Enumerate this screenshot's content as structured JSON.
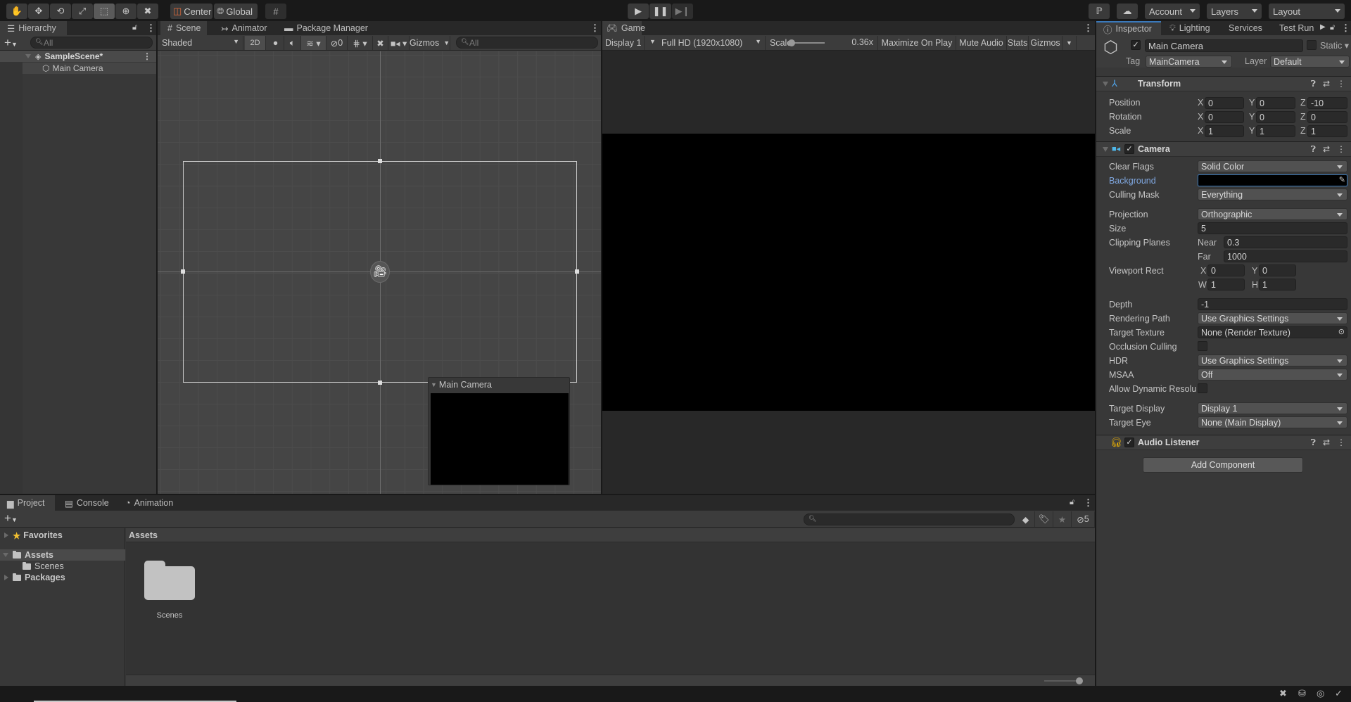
{
  "toolbar": {
    "tools": [
      "hand-tool",
      "move-tool",
      "rotate-tool",
      "scale-tool",
      "rect-tool",
      "transform-tool",
      "custom-editor-tool"
    ],
    "active_tool": "rect-tool",
    "pivot_label": "Center",
    "space_label": "Global",
    "account_label": "Account",
    "layers_label": "Layers",
    "layout_label": "Layout"
  },
  "hierarchy": {
    "tab_label": "Hierarchy",
    "search_placeholder": "All",
    "scene_name": "SampleScene*",
    "items": [
      {
        "label": "Main Camera"
      }
    ]
  },
  "scene_view": {
    "tabs": [
      {
        "label": "Scene"
      },
      {
        "label": "Animator"
      },
      {
        "label": "Package Manager"
      }
    ],
    "shading_mode": "Shaded",
    "mode_2d_label": "2D",
    "hidden_count": "0",
    "gizmos_label": "Gizmos",
    "search_placeholder": "All",
    "camera_preview_title": "Main Camera"
  },
  "game_view": {
    "tab_label": "Game",
    "display": "Display 1",
    "resolution": "Full HD (1920x1080)",
    "scale_label": "Scale",
    "scale_value": "0.36x",
    "scale_slider_fraction": 0.0,
    "maximize_label": "Maximize On Play",
    "mute_label": "Mute Audio",
    "stats_label": "Stats",
    "gizmos_label": "Gizmos"
  },
  "inspector": {
    "tabs": [
      {
        "label": "Inspector"
      },
      {
        "label": "Lighting"
      },
      {
        "label": "Services"
      },
      {
        "label": "Test Run"
      }
    ],
    "object_name": "Main Camera",
    "static_label": "Static",
    "tag_label": "Tag",
    "tag_value": "MainCamera",
    "layer_label": "Layer",
    "layer_value": "Default",
    "transform": {
      "title": "Transform",
      "position": {
        "label": "Position",
        "x": "0",
        "y": "0",
        "z": "-10"
      },
      "rotation": {
        "label": "Rotation",
        "x": "0",
        "y": "0",
        "z": "0"
      },
      "scale": {
        "label": "Scale",
        "x": "1",
        "y": "1",
        "z": "1"
      }
    },
    "camera": {
      "title": "Camera",
      "clear_flags": {
        "label": "Clear Flags",
        "value": "Solid Color"
      },
      "background": {
        "label": "Background",
        "color": "#000000"
      },
      "culling_mask": {
        "label": "Culling Mask",
        "value": "Everything"
      },
      "projection": {
        "label": "Projection",
        "value": "Orthographic"
      },
      "size": {
        "label": "Size",
        "value": "5"
      },
      "clipping": {
        "label": "Clipping Planes",
        "near_label": "Near",
        "near": "0.3",
        "far_label": "Far",
        "far": "1000"
      },
      "viewport": {
        "label": "Viewport Rect",
        "x": "0",
        "y": "0",
        "w": "1",
        "h": "1"
      },
      "depth": {
        "label": "Depth",
        "value": "-1"
      },
      "rendering_path": {
        "label": "Rendering Path",
        "value": "Use Graphics Settings"
      },
      "target_texture": {
        "label": "Target Texture",
        "value": "None (Render Texture)"
      },
      "occlusion_culling": {
        "label": "Occlusion Culling"
      },
      "hdr": {
        "label": "HDR",
        "value": "Use Graphics Settings"
      },
      "msaa": {
        "label": "MSAA",
        "value": "Off"
      },
      "dynamic_res": {
        "label": "Allow Dynamic Resolu"
      },
      "target_display": {
        "label": "Target Display",
        "value": "Display 1"
      },
      "target_eye": {
        "label": "Target Eye",
        "value": "None (Main Display)"
      }
    },
    "audio_listener": {
      "title": "Audio Listener"
    },
    "add_component_label": "Add Component"
  },
  "project": {
    "tabs": [
      {
        "label": "Project"
      },
      {
        "label": "Console"
      },
      {
        "label": "Animation"
      }
    ],
    "tree": {
      "favorites": "Favorites",
      "assets": "Assets",
      "scenes": "Scenes",
      "packages": "Packages"
    },
    "breadcrumb": "Assets",
    "hidden_packages_count": "5",
    "assets": [
      {
        "label": "Scenes",
        "type": "folder"
      }
    ]
  },
  "colors": {
    "accent": "#3a79bb",
    "background_link": "#7fa7e0"
  }
}
